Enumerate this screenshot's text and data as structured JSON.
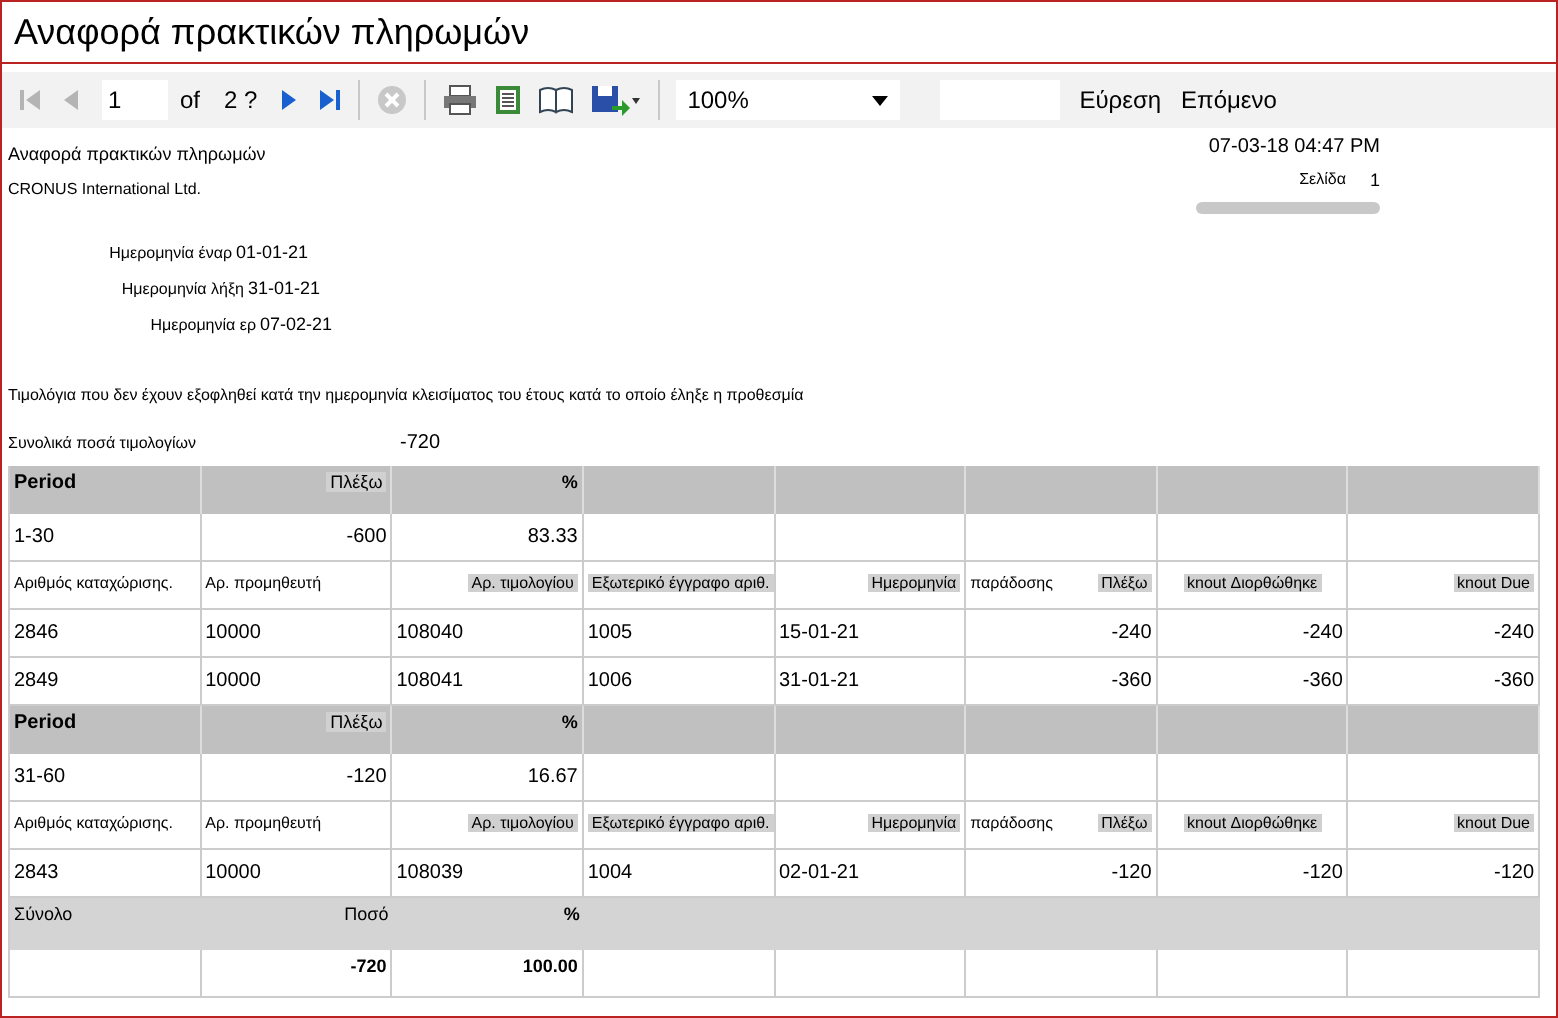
{
  "window": {
    "title": "Αναφορά πρακτικών πληρωμών"
  },
  "toolbar": {
    "nav": [
      {
        "kind": "first",
        "disabled": true
      },
      {
        "kind": "prev",
        "disabled": true
      }
    ],
    "page": "1",
    "of": "of",
    "total": "2 ?",
    "nav2": [
      {
        "kind": "next",
        "disabled": false
      },
      {
        "kind": "last",
        "disabled": false
      }
    ],
    "stop_disabled": true,
    "zoom": "100%",
    "find": "Εύρεση",
    "next": "Επόμενο"
  },
  "report": {
    "title": "Αναφορά πρακτικών πληρωμών",
    "company": "CRONUS International Ltd.",
    "printed": "07-03-18 04:47 PM",
    "page_label": "Σελίδα",
    "page": "1",
    "dates": [
      {
        "label": "Ημερομηνία έναρ",
        "value": "01-01-21"
      },
      {
        "label": "Ημερομηνία λήξη",
        "value": "31-01-21"
      },
      {
        "label": "Ημερομηνία ερ",
        "value": "07-02-21"
      }
    ],
    "description": "Τιμολόγια που δεν έχουν εξοφληθεί κατά την ημερομηνία κλεισίματος του έτους κατά το οποίο έληξε η προθεσμία",
    "total_label": "Συνολικά ποσά τιμολογίων",
    "total": "-720"
  },
  "table": {
    "rows": [
      {
        "kind": "group_header",
        "cells": [
          {
            "text": "Period",
            "highlighted": false
          },
          {
            "text": "Πλέξω",
            "highlighted": true
          },
          {
            "text": "%",
            "highlighted": false
          }
        ]
      },
      {
        "kind": "group",
        "cells": [
          {
            "text": "1-30"
          },
          {
            "text": "-600"
          },
          {
            "text": "83.33"
          }
        ]
      },
      {
        "kind": "column_header",
        "cells": [
          {
            "text": "Αριθμός καταχώρισης.",
            "highlighted": false
          },
          {
            "text": "Αρ. προμηθευτή",
            "highlighted": false
          },
          {
            "text": "Αρ. τιμολογίου",
            "highlighted": true
          },
          {
            "text": "Εξωτερικό έγγραφο αριθ.",
            "highlighted": true
          },
          {
            "text": "Ημερομηνία",
            "highlighted": true
          },
          {
            "text": "παράδοσης",
            "highlighted": false
          },
          {
            "text": "Πλέξω",
            "highlighted": true
          },
          {
            "text": "knout Διορθώθηκε",
            "highlighted": true
          },
          {
            "text": "knout Due",
            "highlighted": true
          }
        ]
      },
      {
        "kind": "data",
        "cells": [
          {
            "text": "2846"
          },
          {
            "text": "10000"
          },
          {
            "text": "108040"
          },
          {
            "text": "1005"
          },
          {
            "text": "15-01-21"
          },
          {
            "text": "-240"
          },
          {
            "text": "-240"
          },
          {
            "text": "-240"
          }
        ]
      },
      {
        "kind": "data",
        "cells": [
          {
            "text": "2849"
          },
          {
            "text": "10000"
          },
          {
            "text": "108041"
          },
          {
            "text": "1006"
          },
          {
            "text": "31-01-21"
          },
          {
            "text": "-360"
          },
          {
            "text": "-360"
          },
          {
            "text": "-360"
          }
        ]
      },
      {
        "kind": "group_header",
        "cells": [
          {
            "text": "Period",
            "highlighted": false
          },
          {
            "text": "Πλέξω",
            "highlighted": true
          },
          {
            "text": "%",
            "highlighted": false
          }
        ]
      },
      {
        "kind": "group",
        "cells": [
          {
            "text": "31-60"
          },
          {
            "text": "-120"
          },
          {
            "text": "16.67"
          }
        ]
      },
      {
        "kind": "column_header",
        "cells": [
          {
            "text": "Αριθμός καταχώρισης.",
            "highlighted": false
          },
          {
            "text": "Αρ. προμηθευτή",
            "highlighted": false
          },
          {
            "text": "Αρ. τιμολογίου",
            "highlighted": true
          },
          {
            "text": "Εξωτερικό έγγραφο αριθ.",
            "highlighted": true
          },
          {
            "text": "Ημερομηνία",
            "highlighted": true
          },
          {
            "text": "παράδοσης",
            "highlighted": false
          },
          {
            "text": "Πλέξω",
            "highlighted": true
          },
          {
            "text": "knout Διορθώθηκε",
            "highlighted": true
          },
          {
            "text": "knout Due",
            "highlighted": true
          }
        ]
      },
      {
        "kind": "data",
        "cells": [
          {
            "text": "2843"
          },
          {
            "text": "10000"
          },
          {
            "text": "108039"
          },
          {
            "text": "1004"
          },
          {
            "text": "02-01-21"
          },
          {
            "text": "-120"
          },
          {
            "text": "-120"
          },
          {
            "text": "-120"
          }
        ]
      },
      {
        "kind": "totals_header",
        "cells": [
          {
            "text": "Σύνολο"
          },
          {
            "text": "Ποσό"
          },
          {
            "text": "%"
          }
        ]
      },
      {
        "kind": "totals",
        "cells": [
          {
            "text": ""
          },
          {
            "text": "-720"
          },
          {
            "text": "100.00"
          }
        ]
      }
    ]
  }
}
